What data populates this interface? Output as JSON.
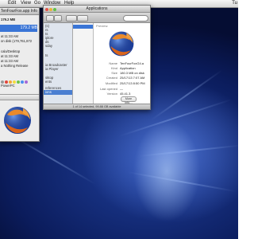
{
  "menubar": {
    "items": [
      "Edit",
      "View",
      "Go",
      "Window",
      "Help"
    ],
    "clock": "Tu"
  },
  "info_window": {
    "title": "TenFourFox.app Info",
    "size_label": "179.2 MB",
    "modified_label": "at 11:33 AM",
    "disk_label": "on disk (179,761,872",
    "powerpc_label": "PowerPC",
    "desktop_label": "cala/Desktop",
    "created_time": "at 11:33 AM",
    "mod_time": "at 11:33 AM",
    "version_label": "a Nothing Release",
    "colors": {
      "selection": "#3a75d6",
      "label_red": "#e0453a",
      "label_orange": "#f3a63a",
      "label_yellow": "#f2dc3c",
      "label_green": "#6ec24a",
      "label_blue": "#4b8ef0",
      "label_purple": "#a468d8",
      "label_gray": "#9a9a9a"
    }
  },
  "finder_window": {
    "title": "Applications",
    "sidebar_items": [
      "(s)",
      "rs",
      "ts",
      "iplore",
      "ds",
      "sday",
      "",
      "ts",
      "",
      "ia Broadcaster",
      "ia Player",
      "",
      "sktop",
      "ents",
      "",
      "references",
      "hings",
      "",
      "ions"
    ],
    "preview": {
      "head": "Preview:",
      "name_key": "Name",
      "name_val": "TenFourFoxG4.a",
      "kind_key": "Kind",
      "kind_val": "Application",
      "size_key": "Size",
      "size_val": "180.3 MB on disk",
      "created_key": "Created",
      "created_val": "25/17/13 7:07 AM",
      "modified_key": "Modified",
      "modified_val": "25/17/13 8:50 PM",
      "opened_key": "Last opened",
      "opened_val": "—",
      "version_key": "Version",
      "version_val": "45.41.3",
      "more_btn": "More info…"
    },
    "status": "1 of 14 selected, 99.88 GB available"
  },
  "icons": {
    "app": "tenfourfox-globe-icon",
    "search": "search-icon"
  }
}
